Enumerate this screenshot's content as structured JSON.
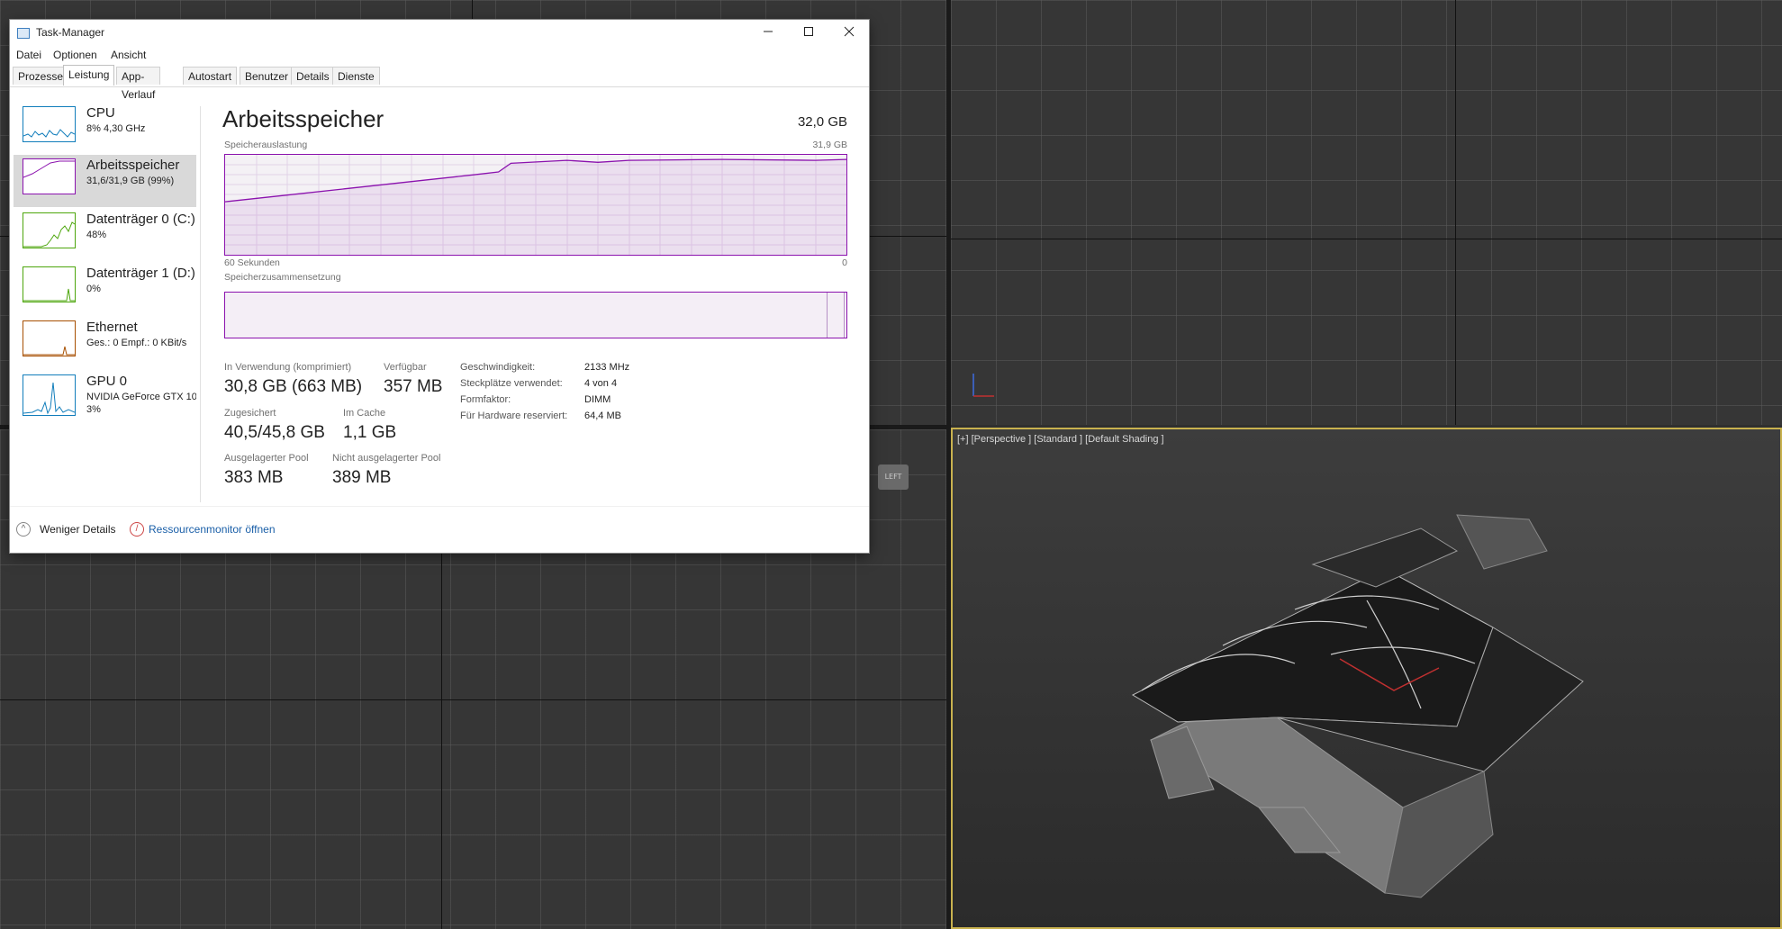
{
  "window": {
    "title": "Task-Manager",
    "minimize_icon": "minimize-icon",
    "maximize_icon": "maximize-icon",
    "close_icon": "close-icon"
  },
  "menu": [
    "Datei",
    "Optionen",
    "Ansicht"
  ],
  "tabs": [
    "Prozesse",
    "Leistung",
    "App-Verlauf",
    "Autostart",
    "Benutzer",
    "Details",
    "Dienste"
  ],
  "active_tab": "Leistung",
  "sidebar": [
    {
      "title": "CPU",
      "sub": "8% 4,30 GHz",
      "color": "#117dbb"
    },
    {
      "title": "Arbeitsspeicher",
      "sub": "31,6/31,9 GB (99%)",
      "color": "#8b12ae"
    },
    {
      "title": "Datenträger 0 (C:)",
      "sub": "48%",
      "color": "#4da60c"
    },
    {
      "title": "Datenträger 1 (D:)",
      "sub": "0%",
      "color": "#4da60c"
    },
    {
      "title": "Ethernet",
      "sub": "Ges.: 0 Empf.: 0 KBit/s",
      "color": "#a74f01"
    },
    {
      "title": "GPU 0",
      "sub": "NVIDIA GeForce GTX 10",
      "sub2": "3%",
      "color": "#117dbb"
    }
  ],
  "main": {
    "title": "Arbeitsspeicher",
    "total": "32,0 GB",
    "usage_label": "Speicherauslastung",
    "usage_max": "31,9 GB",
    "time_left": "60 Sekunden",
    "time_right": "0",
    "composition_label": "Speicherzusammensetzung",
    "stats": {
      "in_use_label": "In Verwendung (komprimiert)",
      "in_use": "30,8 GB (663 MB)",
      "available_label": "Verfügbar",
      "available": "357 MB",
      "committed_label": "Zugesichert",
      "committed": "40,5/45,8 GB",
      "cached_label": "Im Cache",
      "cached": "1,1 GB",
      "paged_label": "Ausgelagerter Pool",
      "paged": "383 MB",
      "nonpaged_label": "Nicht ausgelagerter Pool",
      "nonpaged": "389 MB"
    },
    "props": [
      {
        "k": "Geschwindigkeit:",
        "v": "2133 MHz"
      },
      {
        "k": "Steckplätze verwendet:",
        "v": "4 von 4"
      },
      {
        "k": "Formfaktor:",
        "v": "DIMM"
      },
      {
        "k": "Für Hardware reserviert:",
        "v": "64,4 MB"
      }
    ]
  },
  "footer": {
    "less_details": "Weniger Details",
    "resource_monitor": "Ressourcenmonitor öffnen"
  },
  "viewport": {
    "perspective_label": "[+] [Perspective ] [Standard ] [Default Shading ]",
    "cube_label": "LEFT"
  },
  "colors": {
    "memory": "#8b12ae",
    "viewport_active_border": "#c9b24f"
  }
}
